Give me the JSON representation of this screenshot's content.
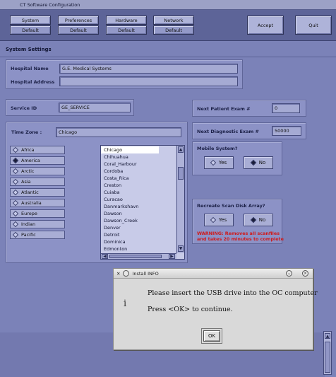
{
  "window": {
    "title": "CT Software Configuration"
  },
  "topbar": {
    "buttons": [
      {
        "label": "System",
        "sub": "Default"
      },
      {
        "label": "Preferences",
        "sub": "Default"
      },
      {
        "label": "Hardware",
        "sub": "Default"
      },
      {
        "label": "Network",
        "sub": "Default"
      }
    ],
    "accept_label": "Accept",
    "quit_label": "Quit"
  },
  "system_settings": {
    "title": "System Settings",
    "hospital_name_label": "Hospital Name",
    "hospital_name_value": "G.E. Medical Systems",
    "hospital_address_label": "Hospital Address",
    "hospital_address_value": "",
    "service_id_label": "Service ID",
    "service_id_value": "GE_SERVICE",
    "next_patient_label": "Next Patient Exam #",
    "next_patient_value": "0",
    "next_diag_label": "Next Diagnostic Exam #",
    "next_diag_value": "50000",
    "timezone_label": "Time Zone :",
    "timezone_value": "Chicago"
  },
  "regions": [
    "Africa",
    "America",
    "Arctic",
    "Asia",
    "Atlantic",
    "Australia",
    "Europe",
    "Indian",
    "Pacific"
  ],
  "selected_region": "America",
  "cities": [
    "Chicago",
    "Chihuahua",
    "Coral_Harbour",
    "Cordoba",
    "Costa_Rica",
    "Creston",
    "Cuiaba",
    "Curacao",
    "Danmarkshavn",
    "Dawson",
    "Dawson_Creek",
    "Denver",
    "Detroit",
    "Dominica",
    "Edmonton"
  ],
  "mobile": {
    "title": "Mobile System?",
    "yes": "Yes",
    "no": "No",
    "selected": "No"
  },
  "recreate": {
    "title": "Recreate Scan Disk Array?",
    "yes": "Yes",
    "no": "No",
    "selected": "No",
    "warning_line1": "WARNING: Removes all scanfiles",
    "warning_line2": "and takes 20 minutes to complete"
  },
  "dialog": {
    "title": "Install INFO",
    "info_symbol": "i",
    "line1": "Please insert the USB drive into the OC computer",
    "line2": "Press <OK> to continue.",
    "ok": "OK"
  },
  "colors": {
    "warning": "#d01a1a",
    "background": "#7b82b8"
  }
}
